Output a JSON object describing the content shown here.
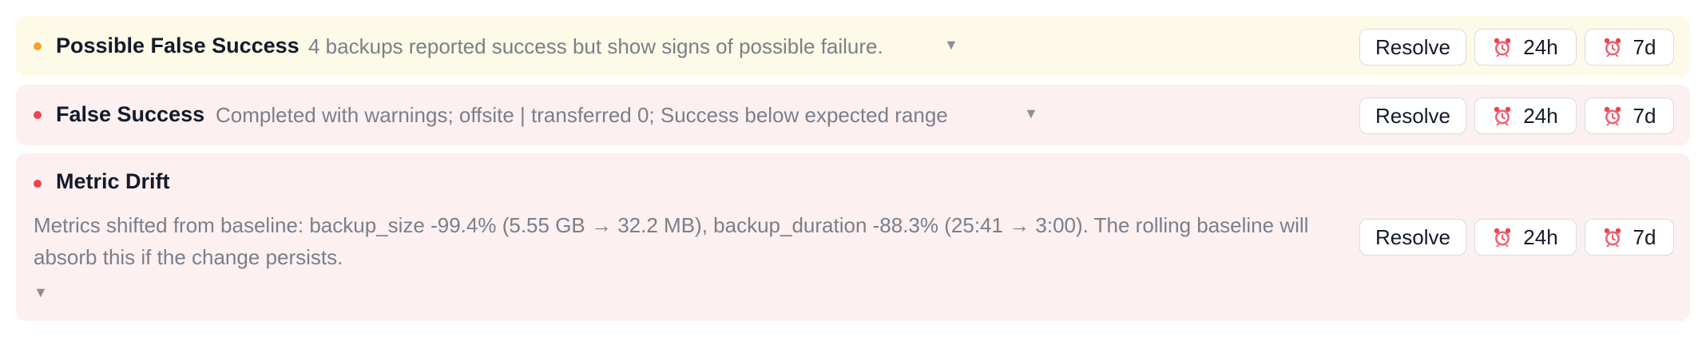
{
  "alerts": [
    {
      "severity": "warning",
      "title": "Possible False Success",
      "description": "4 backups reported success but show signs of possible failure.",
      "expand_glyph": "▼",
      "actions": {
        "resolve": "Resolve",
        "snooze_24h": "24h",
        "snooze_7d": "7d"
      }
    },
    {
      "severity": "error",
      "title": "False Success",
      "description": "Completed with warnings; offsite | transferred 0; Success below expected range",
      "expand_glyph": "▼",
      "actions": {
        "resolve": "Resolve",
        "snooze_24h": "24h",
        "snooze_7d": "7d"
      }
    },
    {
      "severity": "error",
      "title": "Metric Drift",
      "description": "Metrics shifted from baseline: backup_size -99.4% (5.55 GB → 32.2 MB), backup_duration -88.3% (25:41 → 3:00). The rolling baseline will absorb this if the change persists.",
      "expand_glyph": "▼",
      "actions": {
        "resolve": "Resolve",
        "snooze_24h": "24h",
        "snooze_7d": "7d"
      }
    }
  ],
  "colors": {
    "warning_bg": "#fdfae7",
    "error_bg": "#fdf0f1",
    "warning_dot": "#f2a526",
    "error_dot": "#e8474c",
    "title_text": "#141a2a",
    "description_text": "#7a7f8a"
  },
  "icons": {
    "snooze": "alarm-clock-icon",
    "expand": "caret-down-icon"
  }
}
